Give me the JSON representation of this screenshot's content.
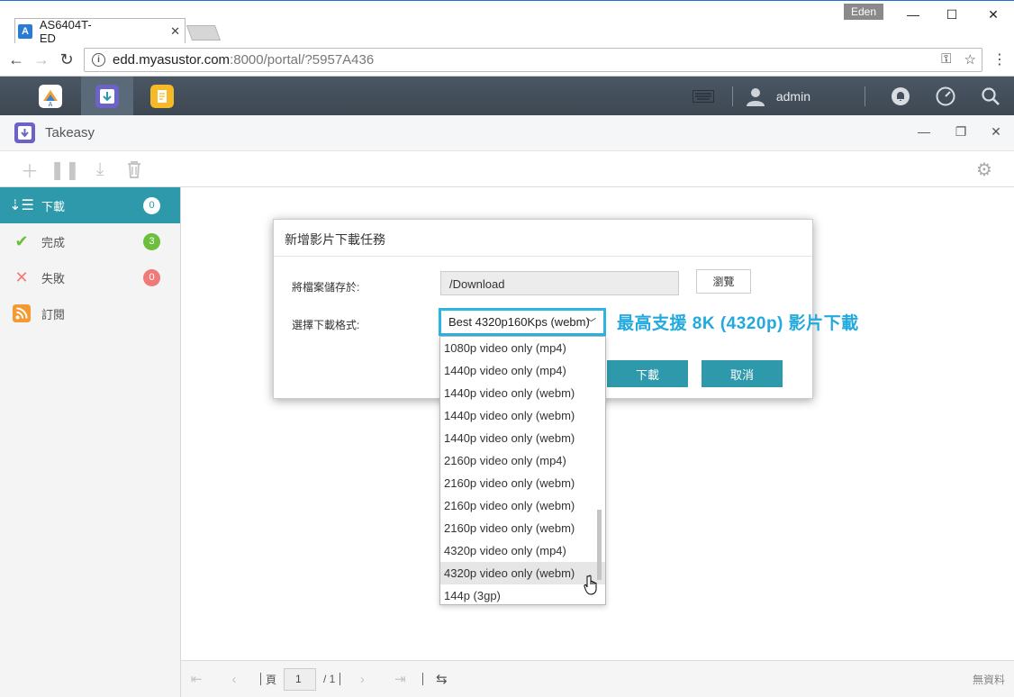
{
  "browser": {
    "tab_title": "AS6404T-ED",
    "tab_favicon": "A",
    "profile_name": "Eden",
    "url_host": "edd.myasustor.com",
    "url_path": ":8000/portal/?5957A436",
    "nav_icons": [
      "back-arrow-icon",
      "forward-arrow-icon",
      "reload-icon"
    ],
    "window_controls": [
      "minimize-icon",
      "maximize-icon",
      "close-icon"
    ]
  },
  "adm": {
    "user": "admin",
    "apps": [
      "app-central-icon",
      "takeasy-icon",
      "notes-icon"
    ]
  },
  "app": {
    "title": "Takeasy",
    "toolbar_icons": [
      "add-icon",
      "pause-icon",
      "download-icon",
      "trash-icon",
      "gear-icon"
    ]
  },
  "sidebar": {
    "items": [
      {
        "label": "下載",
        "count": "0",
        "badge_color": "#ffffff",
        "active": true
      },
      {
        "label": "完成",
        "count": "3",
        "badge_color": "#6cbf3c"
      },
      {
        "label": "失敗",
        "count": "0",
        "badge_color": "#f07a7a"
      },
      {
        "label": "訂閱",
        "count": ""
      }
    ]
  },
  "dialog": {
    "title": "新增影片下載任務",
    "save_label": "將檔案儲存於:",
    "path": "/Download",
    "browse_label": "瀏覽",
    "format_label": "選擇下載格式:",
    "selected_format": "Best 4320p160Kps (webm)",
    "download_label": "下載",
    "cancel_label": "取消"
  },
  "annotation": "最高支援 8K (4320p) 影片下載",
  "dropdown": {
    "options": [
      "1080p video only (mp4)",
      "1440p video only (mp4)",
      "1440p video only (webm)",
      "1440p video only (webm)",
      "1440p video only (webm)",
      "2160p video only (mp4)",
      "2160p video only (webm)",
      "2160p video only (webm)",
      "2160p video only (webm)",
      "4320p video only (mp4)",
      "4320p video only (webm)",
      "144p (3gp)"
    ],
    "hovered_index": 10
  },
  "pager": {
    "page_label": "頁",
    "page_value": "1",
    "total": "/ 1",
    "no_data": "無資料"
  },
  "colors": {
    "accent": "#2d99aa",
    "highlight": "#2bb5e0",
    "adm_bar": "#434f5b"
  }
}
